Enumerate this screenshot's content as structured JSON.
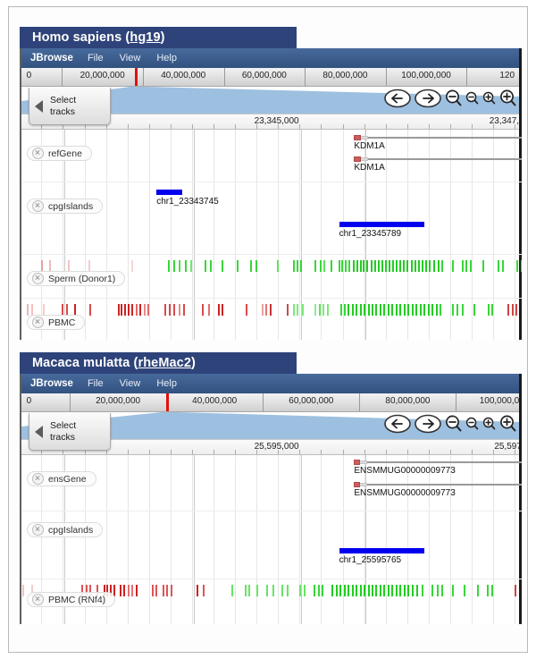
{
  "panels": [
    {
      "title_main": "Homo sapiens (",
      "title_assembly": "hg19",
      "title_close": ")",
      "title_full": "Homo sapiens (hg19)",
      "menu": {
        "brand": "JBrowse",
        "items": [
          "File",
          "View",
          "Help"
        ]
      },
      "overview": {
        "ticks": [
          "0",
          "20,000,000",
          "40,000,000",
          "60,000,000",
          "80,000,000",
          "100,000,000",
          "120"
        ],
        "marker_label": "20,000,000"
      },
      "nav": {
        "pan_left": "pan-left",
        "pan_right": "pan-right",
        "zoom_out_big": "zoom-out-large",
        "zoom_out_small": "zoom-out-small",
        "zoom_in_small": "zoom-in-small",
        "zoom_in_big": "zoom-in-large"
      },
      "localruler": {
        "center_label": "23,345,000",
        "right_label": "23,347,5"
      },
      "select_tracks": {
        "line1": "Select",
        "line2": "tracks"
      },
      "tracks": [
        {
          "name": "refGene",
          "type": "gene",
          "features": [
            {
              "label": "KDM1A",
              "left_pct": 66.5,
              "width_pct": 33.5,
              "exon_pct": 4.2,
              "utr_pct": 4.0
            },
            {
              "label": "KDM1A",
              "left_pct": 66.5,
              "width_pct": 33.5,
              "exon_pct": 4.2,
              "utr_pct": 4.0
            }
          ]
        },
        {
          "name": "cpgIslands",
          "type": "cpg",
          "features": [
            {
              "label": "chr1_23343745",
              "left_pct": 27.0,
              "width_pct": 5.2,
              "row": 0
            },
            {
              "label": "chr1_23345789",
              "left_pct": 63.5,
              "width_pct": 17.0,
              "row": 1
            }
          ]
        },
        {
          "name": "Sperm (Donor1)",
          "type": "methylation",
          "color_low": "#d14b4b",
          "color_high": "#36d636"
        },
        {
          "name": "PBMC",
          "type": "methylation",
          "color_low": "#d14b4b",
          "color_high": "#36d636"
        }
      ]
    },
    {
      "title_main": "Macaca mulatta (",
      "title_assembly": "rheMac2",
      "title_close": ")",
      "title_full": "Macaca mulatta (rheMac2)",
      "menu": {
        "brand": "JBrowse",
        "items": [
          "File",
          "View",
          "Help"
        ]
      },
      "overview": {
        "ticks": [
          "0",
          "20,000,000",
          "40,000,000",
          "60,000,000",
          "80,000,000",
          "100,000,000"
        ],
        "marker_label": "20,000,000"
      },
      "nav": {
        "pan_left": "pan-left",
        "pan_right": "pan-right",
        "zoom_out_big": "zoom-out-large",
        "zoom_out_small": "zoom-out-small",
        "zoom_in_small": "zoom-in-small",
        "zoom_in_big": "zoom-in-large"
      },
      "localruler": {
        "center_label": "25,595,000",
        "right_label": "25,597,"
      },
      "select_tracks": {
        "line1": "Select",
        "line2": "tracks"
      },
      "tracks": [
        {
          "name": "ensGene",
          "type": "gene",
          "features": [
            {
              "label": "ENSMMUG00000009773",
              "left_pct": 66.5,
              "width_pct": 33.5,
              "exon_pct": 3.4,
              "utr_pct": 4.6
            },
            {
              "label": "ENSMMUG00000009773",
              "left_pct": 66.5,
              "width_pct": 33.5,
              "exon_pct": 3.4,
              "utr_pct": 4.6
            }
          ]
        },
        {
          "name": "cpgIslands",
          "type": "cpg",
          "features": [
            {
              "label": "chr1_25595765",
              "left_pct": 63.5,
              "width_pct": 17.0,
              "row": 1
            }
          ]
        },
        {
          "name": "PBMC (RNf4)",
          "type": "methylation",
          "color_low": "#d14b4b",
          "color_high": "#36d636"
        }
      ]
    }
  ],
  "methylation_data": {
    "hs_sperm": [
      [
        4.0,
        "#e8a0a0"
      ],
      [
        5.6,
        "#f0b8b8"
      ],
      [
        9.2,
        "#f2c4c4"
      ],
      [
        13.4,
        "#f4cccc"
      ],
      [
        22.0,
        "#f6d6d6"
      ],
      [
        29.2,
        "#38d638"
      ],
      [
        30.4,
        "#38d638"
      ],
      [
        31.4,
        "#4ade4a"
      ],
      [
        32.6,
        "#38d638"
      ],
      [
        33.8,
        "#6ce86c"
      ],
      [
        36.6,
        "#38d638"
      ],
      [
        37.6,
        "#38d638"
      ],
      [
        40.0,
        "#38d638"
      ],
      [
        43.0,
        "#38d638"
      ],
      [
        45.8,
        "#38d638"
      ],
      [
        46.8,
        "#38d638"
      ],
      [
        51.0,
        "#5ce05c"
      ],
      [
        54.2,
        "#38d638"
      ],
      [
        55.0,
        "#38d638"
      ],
      [
        55.8,
        "#38d638"
      ],
      [
        58.6,
        "#38d638"
      ],
      [
        59.6,
        "#38d638"
      ],
      [
        60.4,
        "#5ce05c"
      ],
      [
        61.8,
        "#38d638"
      ],
      [
        63.4,
        "#38d638"
      ],
      [
        64.0,
        "#38d638"
      ],
      [
        64.6,
        "#38d638"
      ],
      [
        65.4,
        "#38d638"
      ],
      [
        66.2,
        "#22cc22"
      ],
      [
        66.9,
        "#22cc22"
      ],
      [
        67.6,
        "#22cc22"
      ],
      [
        68.3,
        "#22cc22"
      ],
      [
        69.0,
        "#22cc22"
      ],
      [
        69.8,
        "#22cc22"
      ],
      [
        70.5,
        "#22cc22"
      ],
      [
        71.2,
        "#22cc22"
      ],
      [
        71.9,
        "#22cc22"
      ],
      [
        72.6,
        "#22cc22"
      ],
      [
        73.4,
        "#22cc22"
      ],
      [
        74.1,
        "#22cc22"
      ],
      [
        74.8,
        "#22cc22"
      ],
      [
        75.6,
        "#22cc22"
      ],
      [
        76.3,
        "#22cc22"
      ],
      [
        77.0,
        "#22cc22"
      ],
      [
        77.8,
        "#22cc22"
      ],
      [
        78.5,
        "#22cc22"
      ],
      [
        79.3,
        "#22cc22"
      ],
      [
        80.0,
        "#22cc22"
      ],
      [
        80.8,
        "#22cc22"
      ],
      [
        81.5,
        "#22cc22"
      ],
      [
        82.4,
        "#22cc22"
      ],
      [
        83.2,
        "#22cc22"
      ],
      [
        84.0,
        "#38d638"
      ],
      [
        86.0,
        "#38d638"
      ],
      [
        88.0,
        "#38d638"
      ],
      [
        88.8,
        "#38d638"
      ],
      [
        89.6,
        "#38d638"
      ],
      [
        92.2,
        "#38d638"
      ],
      [
        95.2,
        "#38d638"
      ],
      [
        96.0,
        "#38d638"
      ],
      [
        99.0,
        "#38d638"
      ],
      [
        99.8,
        "#38d638"
      ]
    ],
    "hs_pbmc": [
      [
        1.0,
        "#f0b4b4"
      ],
      [
        2.0,
        "#f2c0c0"
      ],
      [
        4.2,
        "#f4cccc"
      ],
      [
        8.0,
        "#d94a4a"
      ],
      [
        9.0,
        "#d94a4a"
      ],
      [
        10.6,
        "#cc2222"
      ],
      [
        13.6,
        "#d94a4a"
      ],
      [
        19.2,
        "#cc2222"
      ],
      [
        19.9,
        "#cc2222"
      ],
      [
        20.6,
        "#cc2222"
      ],
      [
        21.3,
        "#cc2222"
      ],
      [
        22.0,
        "#cc2222"
      ],
      [
        22.8,
        "#e06a6a"
      ],
      [
        23.6,
        "#cc2222"
      ],
      [
        24.4,
        "#e88a8a"
      ],
      [
        25.2,
        "#e06a6a"
      ],
      [
        28.6,
        "#d94a4a"
      ],
      [
        29.4,
        "#d94a4a"
      ],
      [
        30.4,
        "#d94a4a"
      ],
      [
        31.4,
        "#e88a8a"
      ],
      [
        32.4,
        "#d94a4a"
      ],
      [
        36.0,
        "#d94a4a"
      ],
      [
        37.4,
        "#e07070"
      ],
      [
        39.2,
        "#cc2222"
      ],
      [
        40.0,
        "#cc2222"
      ],
      [
        44.8,
        "#d94a4a"
      ],
      [
        48.0,
        "#e8a0a0"
      ],
      [
        48.8,
        "#dd7a7a"
      ],
      [
        49.6,
        "#c83030"
      ],
      [
        53.0,
        "#c05050"
      ],
      [
        54.2,
        "#7ce87c"
      ],
      [
        55.0,
        "#7ce87c"
      ],
      [
        56.0,
        "#7ce87c"
      ],
      [
        58.6,
        "#8cec8c"
      ],
      [
        59.4,
        "#60e060"
      ],
      [
        60.2,
        "#7ce87c"
      ],
      [
        61.0,
        "#7ce87c"
      ],
      [
        63.8,
        "#38d638"
      ],
      [
        64.5,
        "#38d638"
      ],
      [
        65.2,
        "#22cc22"
      ],
      [
        66.0,
        "#22cc22"
      ],
      [
        66.8,
        "#22cc22"
      ],
      [
        67.6,
        "#22cc22"
      ],
      [
        68.4,
        "#22cc22"
      ],
      [
        69.2,
        "#22cc22"
      ],
      [
        70.0,
        "#22cc22"
      ],
      [
        70.8,
        "#22cc22"
      ],
      [
        71.6,
        "#22cc22"
      ],
      [
        72.4,
        "#22cc22"
      ],
      [
        73.2,
        "#22cc22"
      ],
      [
        74.0,
        "#22cc22"
      ],
      [
        74.8,
        "#22cc22"
      ],
      [
        75.6,
        "#22cc22"
      ],
      [
        76.4,
        "#22cc22"
      ],
      [
        77.2,
        "#22cc22"
      ],
      [
        78.0,
        "#22cc22"
      ],
      [
        78.8,
        "#22cc22"
      ],
      [
        79.6,
        "#22cc22"
      ],
      [
        80.4,
        "#22cc22"
      ],
      [
        81.2,
        "#22cc22"
      ],
      [
        82.0,
        "#22cc22"
      ],
      [
        82.8,
        "#22cc22"
      ],
      [
        83.6,
        "#38d638"
      ],
      [
        86.0,
        "#38d638"
      ],
      [
        87.0,
        "#38d638"
      ],
      [
        88.0,
        "#38d638"
      ],
      [
        90.4,
        "#38d638"
      ],
      [
        93.2,
        "#38d638"
      ],
      [
        94.0,
        "#38d638"
      ],
      [
        97.2,
        "#cc4444"
      ],
      [
        98.0,
        "#cc4444"
      ],
      [
        98.8,
        "#cc4444"
      ]
    ],
    "mm_pbmc": [
      [
        0.2,
        "#f2c0c0"
      ],
      [
        2.0,
        "#f4cccc"
      ],
      [
        12.0,
        "#dd5555"
      ],
      [
        12.8,
        "#dd5555"
      ],
      [
        13.6,
        "#dd5555"
      ],
      [
        15.0,
        "#dd5555"
      ],
      [
        16.4,
        "#cc2222"
      ],
      [
        17.0,
        "#cc2222"
      ],
      [
        17.6,
        "#cc2222"
      ],
      [
        18.4,
        "#cc2222"
      ],
      [
        19.6,
        "#cc2222"
      ],
      [
        20.4,
        "#cc2222"
      ],
      [
        21.2,
        "#e07070"
      ],
      [
        22.0,
        "#e07070"
      ],
      [
        22.8,
        "#cc2222"
      ],
      [
        26.0,
        "#dd5555"
      ],
      [
        26.8,
        "#dd5555"
      ],
      [
        28.2,
        "#dd5555"
      ],
      [
        29.0,
        "#dd5555"
      ],
      [
        29.8,
        "#dd5555"
      ],
      [
        35.0,
        "#cc2222"
      ],
      [
        36.2,
        "#dd5555"
      ],
      [
        42.0,
        "#66e466"
      ],
      [
        44.6,
        "#66e466"
      ],
      [
        45.4,
        "#66e466"
      ],
      [
        47.0,
        "#66e466"
      ],
      [
        49.0,
        "#66e466"
      ],
      [
        50.2,
        "#66e466"
      ],
      [
        52.0,
        "#66e466"
      ],
      [
        53.0,
        "#66e466"
      ],
      [
        55.6,
        "#66e466"
      ],
      [
        56.4,
        "#66e466"
      ],
      [
        58.4,
        "#38d638"
      ],
      [
        59.2,
        "#38d638"
      ],
      [
        60.0,
        "#38d638"
      ],
      [
        62.0,
        "#22cc22"
      ],
      [
        62.8,
        "#22cc22"
      ],
      [
        63.6,
        "#22cc22"
      ],
      [
        64.4,
        "#22cc22"
      ],
      [
        65.2,
        "#22cc22"
      ],
      [
        66.0,
        "#22cc22"
      ],
      [
        66.8,
        "#22cc22"
      ],
      [
        67.6,
        "#22cc22"
      ],
      [
        68.4,
        "#22cc22"
      ],
      [
        69.2,
        "#22cc22"
      ],
      [
        70.0,
        "#22cc22"
      ],
      [
        70.8,
        "#22cc22"
      ],
      [
        71.6,
        "#22cc22"
      ],
      [
        72.4,
        "#22cc22"
      ],
      [
        73.2,
        "#22cc22"
      ],
      [
        74.0,
        "#22cc22"
      ],
      [
        74.8,
        "#22cc22"
      ],
      [
        75.6,
        "#22cc22"
      ],
      [
        76.4,
        "#22cc22"
      ],
      [
        77.2,
        "#22cc22"
      ],
      [
        78.0,
        "#22cc22"
      ],
      [
        79.0,
        "#22cc22"
      ],
      [
        80.0,
        "#38d638"
      ],
      [
        82.0,
        "#38d638"
      ],
      [
        83.0,
        "#38d638"
      ],
      [
        84.0,
        "#38d638"
      ],
      [
        86.0,
        "#38d638"
      ],
      [
        88.4,
        "#38d638"
      ],
      [
        91.0,
        "#38d638"
      ],
      [
        93.0,
        "#38d638"
      ],
      [
        94.0,
        "#38d638"
      ],
      [
        98.6,
        "#cc4444"
      ]
    ]
  }
}
